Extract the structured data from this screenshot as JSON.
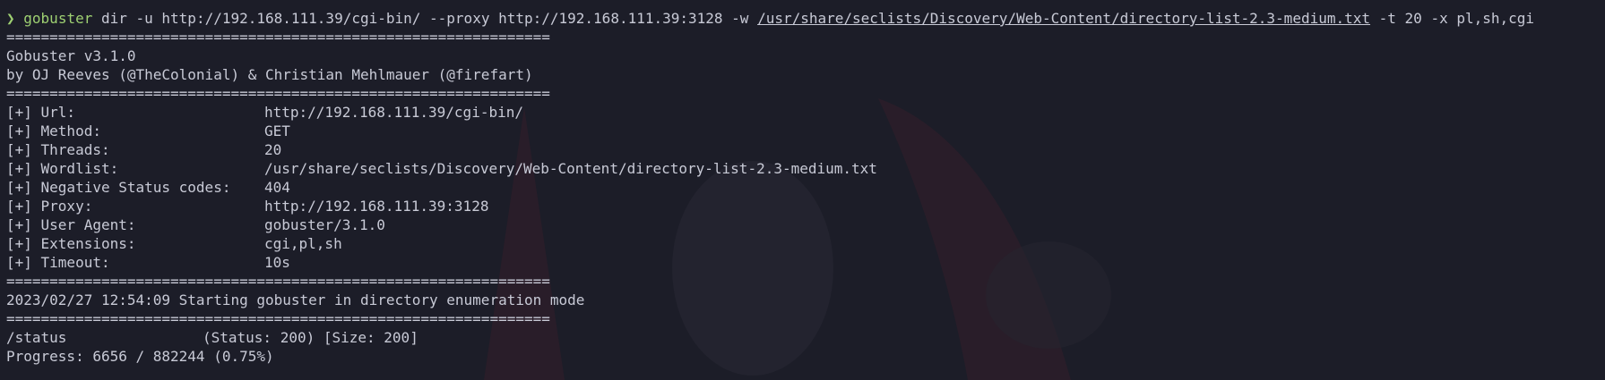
{
  "command": {
    "prompt_symbol": "❯",
    "name": "gobuster",
    "args_before_path": " dir -u http://192.168.111.39/cgi-bin/ --proxy http://192.168.111.39:3128 -w ",
    "wordlist_path": "/usr/share/seclists/Discovery/Web-Content/directory-list-2.3-medium.txt",
    "args_after_path": " -t 20 -x pl,sh,cgi"
  },
  "separator": "===============================================================",
  "banner": {
    "version": "Gobuster v3.1.0",
    "authors": "by OJ Reeves (@TheColonial) & Christian Mehlmauer (@firefart)"
  },
  "config": [
    {
      "key": "[+] Url:",
      "value": "http://192.168.111.39/cgi-bin/"
    },
    {
      "key": "[+] Method:",
      "value": "GET"
    },
    {
      "key": "[+] Threads:",
      "value": "20"
    },
    {
      "key": "[+] Wordlist:",
      "value": "/usr/share/seclists/Discovery/Web-Content/directory-list-2.3-medium.txt"
    },
    {
      "key": "[+] Negative Status codes:",
      "value": "404"
    },
    {
      "key": "[+] Proxy:",
      "value": "http://192.168.111.39:3128"
    },
    {
      "key": "[+] User Agent:",
      "value": "gobuster/3.1.0"
    },
    {
      "key": "[+] Extensions:",
      "value": "cgi,pl,sh"
    },
    {
      "key": "[+] Timeout:",
      "value": "10s"
    }
  ],
  "start_message": "2023/02/27 12:54:09 Starting gobuster in directory enumeration mode",
  "results": [
    {
      "path": "/status",
      "info": "(Status: 200) [Size: 200]"
    }
  ],
  "progress": "Progress: 6656 / 882244 (0.75%)",
  "colors": {
    "background": "#1c1d28",
    "foreground": "#c8cad6",
    "accent_green": "#9ed072"
  }
}
